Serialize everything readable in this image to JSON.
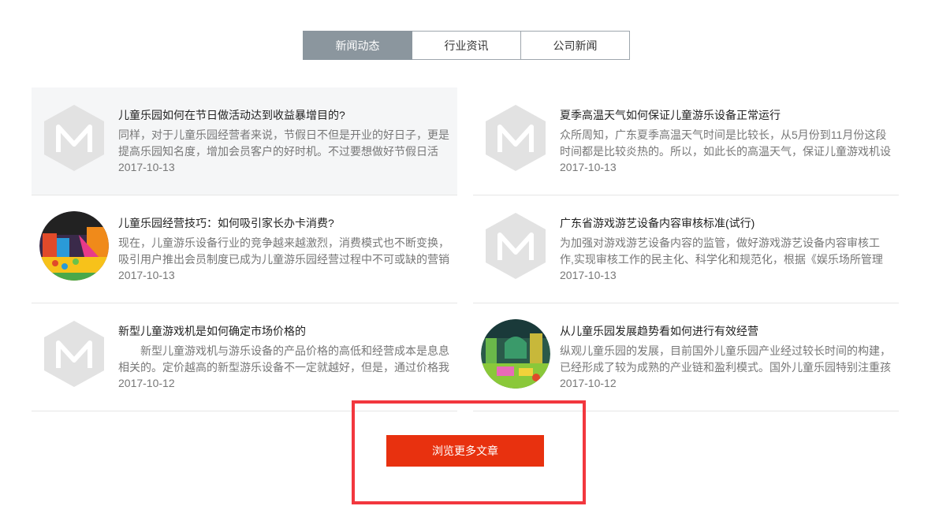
{
  "tabs": [
    {
      "label": "新闻动态",
      "active": true
    },
    {
      "label": "行业资讯",
      "active": false
    },
    {
      "label": "公司新闻",
      "active": false
    }
  ],
  "news": [
    {
      "title": "儿童乐园如何在节日做活动达到收益暴增目的?",
      "excerpt": "同样，对于儿童乐园经营者来说，节假日不但是开业的好日子，更是提高乐园知名度，增加会员客户的好时机。不过要想做好节假日活",
      "date": "2017-10-13",
      "thumb": "hexagon-m-icon"
    },
    {
      "title": "夏季高温天气如何保证儿童游乐设备正常运行",
      "excerpt": "众所周知，广东夏季高温天气时间是比较长，从5月份到11月份这段时间都是比较炎热的。所以，如此长的高温天气，保证儿童游戏机设",
      "date": "2017-10-13",
      "thumb": "hexagon-m-icon"
    },
    {
      "title": "儿童乐园经营技巧：如何吸引家长办卡消费?",
      "excerpt": "现在，儿童游乐设备行业的竞争越来越激烈，消费模式也不断变换，吸引用户推出会员制度已成为儿童游乐园经营过程中不可或缺的营销",
      "date": "2017-10-13",
      "thumb": "playground-photo"
    },
    {
      "title": "广东省游戏游艺设备内容审核标准(试行)",
      "excerpt": "为加强对游戏游艺设备内容的监管，做好游戏游艺设备内容审核工作,实现审核工作的民主化、科学化和规范化，根据《娱乐场所管理",
      "date": "2017-10-13",
      "thumb": "hexagon-m-icon"
    },
    {
      "title": "新型儿童游戏机是如何确定市场价格的",
      "excerpt": "　　新型儿童游戏机与游乐设备的产品价格的高低和经营成本是息息相关的。定价越高的新型游乐设备不一定就越好，但是，通过价格我",
      "date": "2017-10-12",
      "thumb": "hexagon-m-icon"
    },
    {
      "title": "从儿童乐园发展趋势看如何进行有效经营",
      "excerpt": "纵观儿童乐园的发展，目前国外儿童乐园产业经过较长时间的构建，已经形成了较为成熟的产业链和盈利模式。国外儿童乐园特别注重孩",
      "date": "2017-10-12",
      "thumb": "indoor-park-photo"
    }
  ],
  "more_button": "浏览更多文章",
  "colors": {
    "tab_active_bg": "#8b969e",
    "button_bg": "#e8310f",
    "highlight_border": "#f2373e"
  }
}
